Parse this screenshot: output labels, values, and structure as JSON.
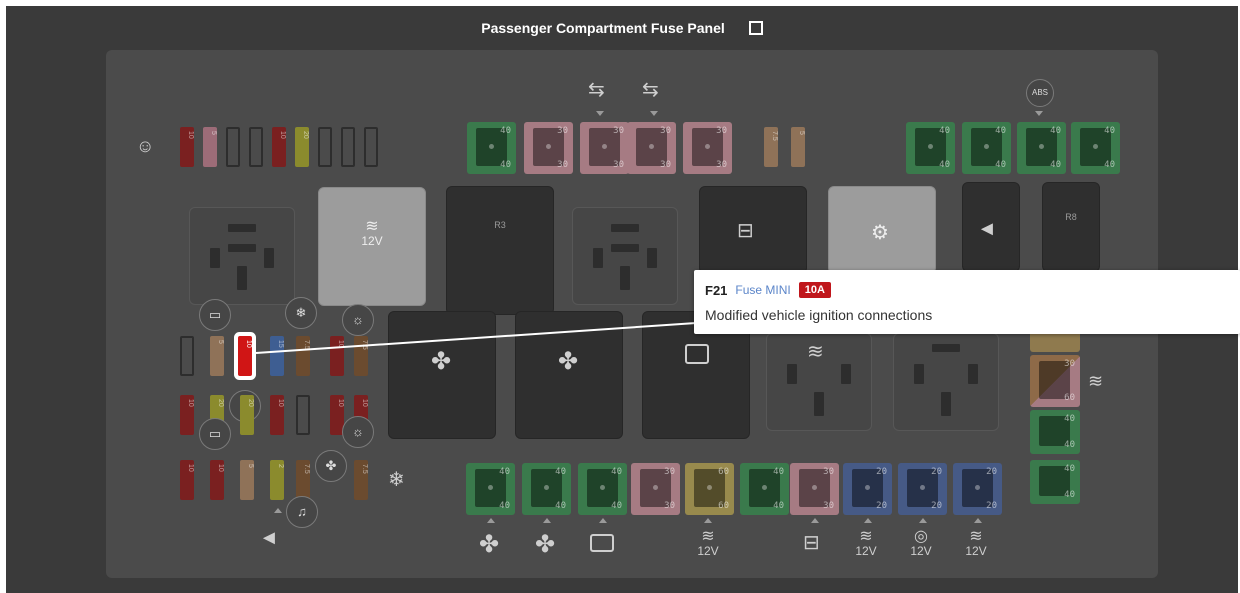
{
  "title": "Passenger Compartment Fuse Panel",
  "relays": {
    "r3": "R3",
    "r8": "R8",
    "voltage": "12V"
  },
  "top_maxi": [
    {
      "top": "40",
      "bottom": "40",
      "color": "green"
    },
    {
      "top": "30",
      "bottom": "30",
      "color": "pink"
    },
    {
      "top": "30",
      "bottom": "30",
      "color": "pink"
    },
    {
      "top": "30",
      "bottom": "30",
      "color": "pink"
    },
    {
      "top": "30",
      "bottom": "30",
      "color": "pink"
    }
  ],
  "top_right_maxi": [
    {
      "top": "40",
      "bottom": "40",
      "color": "green"
    },
    {
      "top": "40",
      "bottom": "40",
      "color": "green"
    },
    {
      "top": "40",
      "bottom": "40",
      "color": "green"
    },
    {
      "top": "40",
      "bottom": "40",
      "color": "green"
    }
  ],
  "bottom_maxi": [
    {
      "top": "40",
      "bottom": "40",
      "color": "green"
    },
    {
      "top": "40",
      "bottom": "40",
      "color": "green"
    },
    {
      "top": "40",
      "bottom": "40",
      "color": "green"
    },
    {
      "top": "30",
      "bottom": "30",
      "color": "pink"
    },
    {
      "top": "60",
      "bottom": "60",
      "color": "yellow"
    },
    {
      "top": "40",
      "bottom": "40",
      "color": "green"
    },
    {
      "top": "30",
      "bottom": "30",
      "color": "pink"
    },
    {
      "top": "20",
      "bottom": "20",
      "color": "blue"
    },
    {
      "top": "20",
      "bottom": "20",
      "color": "blue"
    },
    {
      "top": "20",
      "bottom": "20",
      "color": "blue"
    }
  ],
  "right_column_maxi": [
    {
      "top": "30",
      "bottom": "60"
    },
    {
      "top": "40",
      "bottom": "40"
    },
    {
      "top": "40",
      "bottom": "40"
    }
  ],
  "mini_labels": {
    "ten": "10",
    "five": "5",
    "seven_five": "7.5",
    "two": "2",
    "fifteen": "15",
    "twenty": "20"
  },
  "tooltip": {
    "id": "F21",
    "type": "Fuse MINI",
    "amperage": "10A",
    "description": "Modified vehicle ignition connections"
  },
  "colors": {
    "highlight": "#d01515",
    "badge": "#c0161b",
    "type_link": "#5b85c9"
  }
}
